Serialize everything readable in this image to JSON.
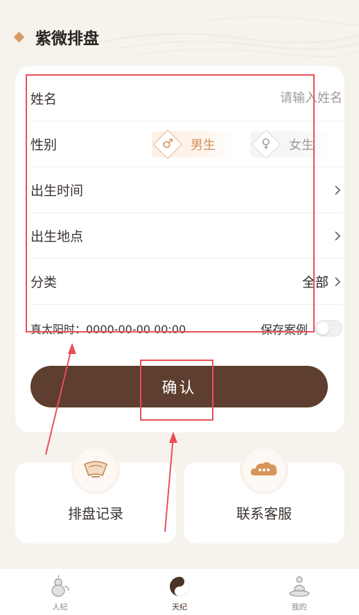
{
  "page": {
    "title": "紫微排盘"
  },
  "form": {
    "name_label": "姓名",
    "name_placeholder": "请输入姓名",
    "name_value": "",
    "gender_label": "性别",
    "gender_male": "男生",
    "gender_female": "女生",
    "gender_selected": "男生",
    "birth_time_label": "出生时间",
    "birth_place_label": "出生地点",
    "category_label": "分类",
    "category_value": "全部",
    "solar_time": "真太阳时：0000-00-00 00:00",
    "save_case_label": "保存案例",
    "save_case_on": false
  },
  "confirm_label": "确认",
  "tiles": {
    "records_label": "排盘记录",
    "service_label": "联系客服"
  },
  "tabbar": {
    "tab1_label": "人纪",
    "tab2_label": "天纪",
    "tab3_label": "我的",
    "active": "天纪"
  },
  "colors": {
    "accent": "#d39158",
    "primary_button": "#5e3e2e",
    "background": "#f6f2ec",
    "annotation": "#e94e57"
  },
  "icons": {
    "title_marker": "diamond-marker-icon",
    "male": "male-symbol-icon",
    "female": "female-symbol-icon",
    "chevron": "chevron-right-icon",
    "records": "fan-scroll-icon",
    "service": "cloud-chat-icon",
    "tab1": "gourd-icon",
    "tab2": "yin-yang-icon",
    "tab3": "meditation-figure-icon"
  }
}
